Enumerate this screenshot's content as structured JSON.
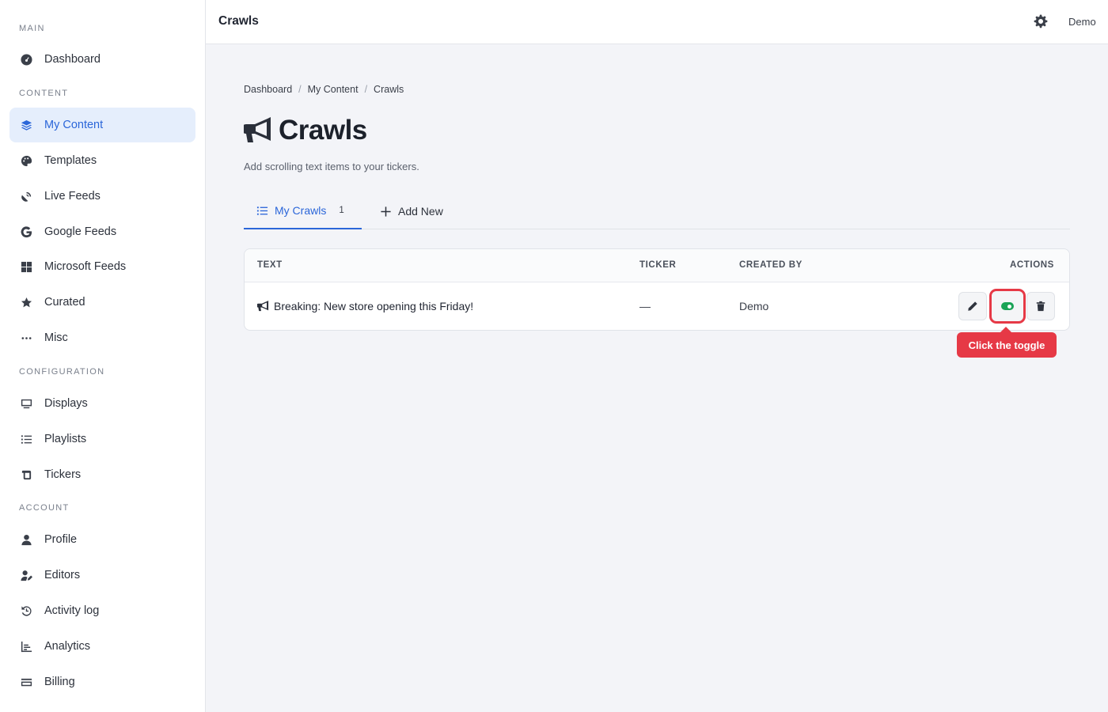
{
  "sidebar": {
    "sections": {
      "main": "MAIN",
      "content": "CONTENT",
      "configuration": "CONFIGURATION",
      "account": "ACCOUNT"
    },
    "items": {
      "dashboard": {
        "label": "Dashboard",
        "icon": "dashboard-gauge-icon"
      },
      "my_content": {
        "label": "My Content",
        "icon": "layers-icon"
      },
      "templates": {
        "label": "Templates",
        "icon": "palette-icon"
      },
      "live_feeds": {
        "label": "Live Feeds",
        "icon": "satellite-dish-icon"
      },
      "google_feeds": {
        "label": "Google Feeds",
        "icon": "google-icon"
      },
      "microsoft_feeds": {
        "label": "Microsoft Feeds",
        "icon": "windows-icon"
      },
      "curated": {
        "label": "Curated",
        "icon": "star-icon"
      },
      "misc": {
        "label": "Misc",
        "icon": "ellipsis-icon"
      },
      "displays": {
        "label": "Displays",
        "icon": "monitor-icon"
      },
      "playlists": {
        "label": "Playlists",
        "icon": "list-icon"
      },
      "tickers": {
        "label": "Tickers",
        "icon": "scroll-icon"
      },
      "profile": {
        "label": "Profile",
        "icon": "user-icon"
      },
      "editors": {
        "label": "Editors",
        "icon": "user-pen-icon"
      },
      "activity_log": {
        "label": "Activity log",
        "icon": "history-icon"
      },
      "analytics": {
        "label": "Analytics",
        "icon": "chart-icon"
      },
      "billing": {
        "label": "Billing",
        "icon": "credit-card-icon"
      }
    },
    "active_color": "#2b66d9"
  },
  "topbar": {
    "title": "Crawls",
    "user": "Demo"
  },
  "breadcrumb": {
    "items": [
      "Dashboard",
      "My Content",
      "Crawls"
    ],
    "separator": "/"
  },
  "page": {
    "title": "Crawls",
    "subtitle": "Add scrolling text items to your tickers."
  },
  "tabs": {
    "my_crawls": {
      "label": "My Crawls",
      "count": "1"
    },
    "add_new": {
      "label": "Add New"
    }
  },
  "table": {
    "headers": {
      "text": "TEXT",
      "ticker": "TICKER",
      "created_by": "CREATED BY",
      "actions": "ACTIONS"
    },
    "rows": [
      {
        "text": "Breaking: New store opening this Friday!",
        "ticker": "—",
        "created_by": "Demo",
        "enabled": true
      }
    ]
  },
  "tooltip": {
    "text": "Click the toggle",
    "color": "#e63946"
  }
}
